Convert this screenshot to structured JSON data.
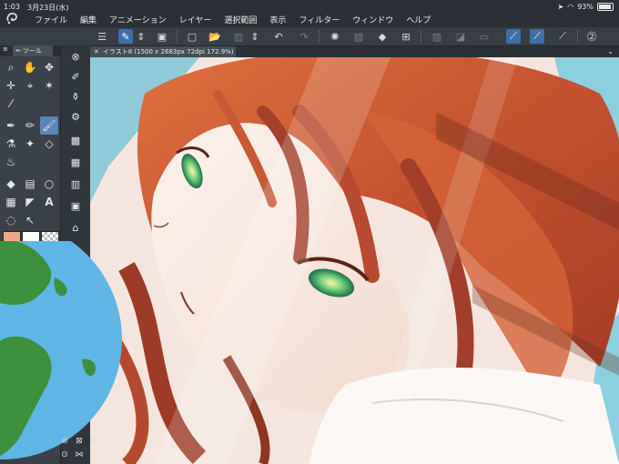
{
  "status": {
    "time": "1:03",
    "date": "3月23日(水)",
    "battery_text": "93%",
    "battery_level": 0.93
  },
  "menu": [
    "ファイル",
    "編集",
    "アニメーション",
    "レイヤー",
    "選択範囲",
    "表示",
    "フィルター",
    "ウィンドウ",
    "ヘルプ"
  ],
  "tool_palette": {
    "tab_label": "ツール"
  },
  "canvas": {
    "tab_title": "イラスト8 (1500 x 2683px 72dpi 172.9%)"
  },
  "tools": [
    {
      "name": "zoom-icon",
      "glyph": "🔍"
    },
    {
      "name": "hand-icon",
      "glyph": "✋"
    },
    {
      "name": "rotate-icon",
      "glyph": "✥"
    },
    {
      "name": "move-layer-icon",
      "glyph": "✛"
    },
    {
      "name": "auto-select-icon",
      "glyph": "⌖"
    },
    {
      "name": "eyedropper-icon",
      "glyph": "✎"
    },
    {
      "name": "pen-icon",
      "glyph": "✒"
    },
    {
      "name": "pencil-icon",
      "glyph": "✏"
    },
    {
      "name": "brush-icon",
      "glyph": "🖌"
    },
    {
      "name": "airbrush-icon",
      "glyph": "✺"
    },
    {
      "name": "decoration-icon",
      "glyph": "✦"
    },
    {
      "name": "eraser-icon",
      "glyph": "⌫"
    },
    {
      "name": "blend-icon",
      "glyph": "💧"
    },
    {
      "name": "fill-icon",
      "glyph": "◆"
    },
    {
      "name": "gradient-icon",
      "glyph": "▤"
    },
    {
      "name": "figure-icon",
      "glyph": "◯"
    },
    {
      "name": "frame-icon",
      "glyph": "▦"
    },
    {
      "name": "ruler-icon",
      "glyph": "◤"
    },
    {
      "name": "text-icon",
      "glyph": "A"
    },
    {
      "name": "balloon-icon",
      "glyph": "💬"
    },
    {
      "name": "correct-line-icon",
      "glyph": "↖"
    }
  ],
  "colors": {
    "main_color": "#f0a88c",
    "sub_color": "#ffffff",
    "selected_tool": "#5b84b8"
  }
}
